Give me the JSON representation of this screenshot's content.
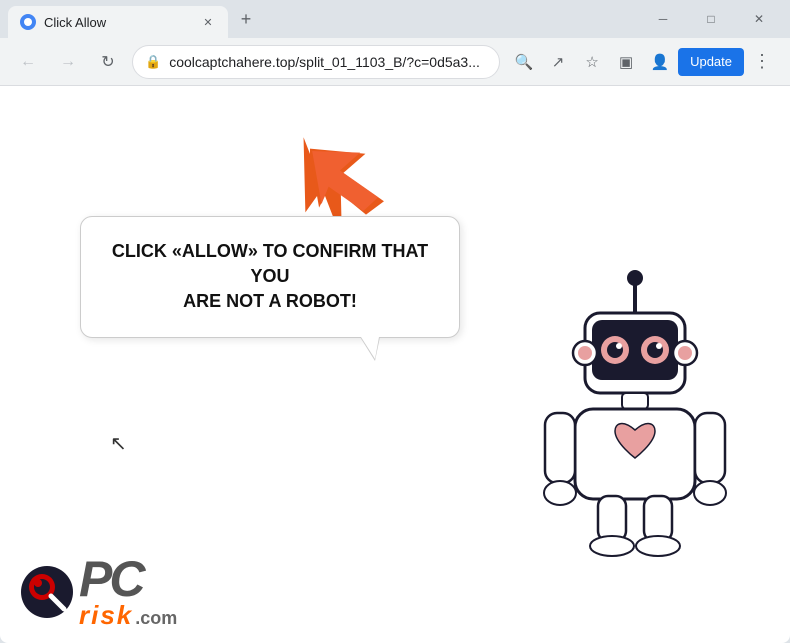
{
  "window": {
    "title": "Click Allow",
    "tab_title": "Click Allow",
    "favicon_aria": "globe-icon"
  },
  "toolbar": {
    "address": "coolcaptchahere.top/split_01_1103_B/?c=0d5a3...",
    "update_label": "Update"
  },
  "controls": {
    "minimize": "─",
    "maximize": "□",
    "close": "✕",
    "new_tab": "+",
    "back": "←",
    "forward": "→",
    "refresh": "↻",
    "search_icon": "🔍",
    "share_icon": "↗",
    "bookmark_icon": "☆",
    "sidebar_icon": "▣",
    "profile_icon": "👤",
    "menu_icon": "⋮"
  },
  "page": {
    "bubble_text_line1": "CLICK «ALLOW» TO CONFIRM THAT YOU",
    "bubble_text_line2": "ARE NOT A ROBOT!",
    "arrow_aria": "orange arrow pointing up-left",
    "logo_pc": "PC",
    "logo_risk": "risk",
    "logo_com": ".com"
  }
}
